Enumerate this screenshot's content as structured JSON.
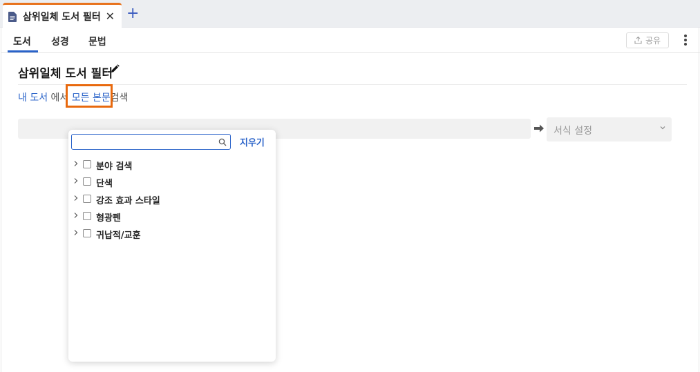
{
  "tab": {
    "title": "삼위일체 도서 필터",
    "close_glyph": "✕",
    "new_tab_glyph": "+"
  },
  "subtabs": [
    {
      "label": "도서",
      "active": true
    },
    {
      "label": "성경",
      "active": false
    },
    {
      "label": "문법",
      "active": false
    }
  ],
  "toolbar": {
    "share_label": "공유"
  },
  "document": {
    "title": "삼위일체 도서 필터"
  },
  "breadcrumb": {
    "scope": "내 도서",
    "in_text": "에서",
    "target": "모든 본문",
    "action": "검색"
  },
  "format_select": {
    "placeholder": "서식 설정"
  },
  "dropdown": {
    "search_placeholder": "",
    "clear_label": "지우기",
    "items": [
      {
        "label": "분야 검색",
        "checked": false
      },
      {
        "label": "단색",
        "checked": false
      },
      {
        "label": "강조 효과 스타일",
        "checked": false
      },
      {
        "label": "형광펜",
        "checked": false
      },
      {
        "label": "귀납적/교훈",
        "checked": false
      }
    ]
  },
  "colors": {
    "accent": "#2a63c9",
    "highlight": "#e8690e",
    "tab_top": "#e8731e"
  }
}
